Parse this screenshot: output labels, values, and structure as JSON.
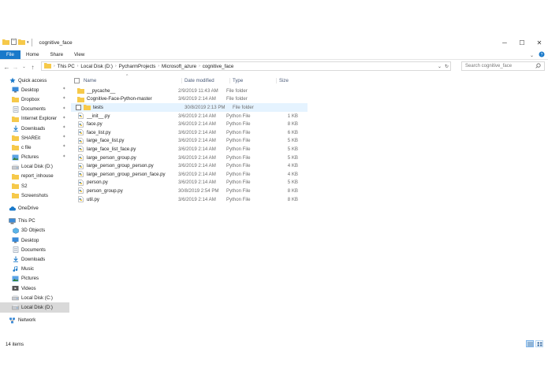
{
  "window": {
    "title": "cognitive_face",
    "controls": {
      "minimize": "─",
      "maximize": "☐",
      "close": "✕"
    }
  },
  "ribbon": {
    "tabs": [
      "File",
      "Home",
      "Share",
      "View"
    ],
    "expand_icon": "chevron-down-icon",
    "help_icon": "help-icon"
  },
  "address": {
    "crumbs": [
      "This PC",
      "Local Disk (D:)",
      "PycharmProjects",
      "Microsoft_azure",
      "cognitive_face"
    ],
    "search_placeholder": "Search cognitive_face"
  },
  "nav": {
    "items": [
      {
        "label": "Quick access",
        "icon": "star-icon",
        "level": 0,
        "pinned": false
      },
      {
        "label": "Desktop",
        "icon": "desktop-icon",
        "level": 1,
        "pinned": true
      },
      {
        "label": "Dropbox",
        "icon": "folder-icon",
        "level": 1,
        "pinned": true
      },
      {
        "label": "Documents",
        "icon": "documents-icon",
        "level": 1,
        "pinned": true
      },
      {
        "label": "Internet Explorer",
        "icon": "folder-icon",
        "level": 1,
        "pinned": true
      },
      {
        "label": "Downloads",
        "icon": "downloads-icon",
        "level": 1,
        "pinned": true
      },
      {
        "label": "SHAREit",
        "icon": "folder-icon",
        "level": 1,
        "pinned": true
      },
      {
        "label": "c file",
        "icon": "folder-icon",
        "level": 1,
        "pinned": true
      },
      {
        "label": "Pictures",
        "icon": "pictures-icon",
        "level": 1,
        "pinned": true
      },
      {
        "label": "Local Disk (D:)",
        "icon": "drive-icon",
        "level": 1,
        "pinned": false
      },
      {
        "label": "report_inhouse",
        "icon": "folder-icon",
        "level": 1,
        "pinned": false
      },
      {
        "label": "S2",
        "icon": "folder-icon",
        "level": 1,
        "pinned": false
      },
      {
        "label": "Screenshots",
        "icon": "folder-icon",
        "level": 1,
        "pinned": false
      },
      {
        "label": "",
        "icon": "",
        "level": 0,
        "pinned": false,
        "spacer": true
      },
      {
        "label": "OneDrive",
        "icon": "cloud-icon",
        "level": 0,
        "pinned": false
      },
      {
        "label": "",
        "icon": "",
        "level": 0,
        "pinned": false,
        "spacer": true
      },
      {
        "label": "This PC",
        "icon": "computer-icon",
        "level": 0,
        "pinned": false
      },
      {
        "label": "3D Objects",
        "icon": "cube-icon",
        "level": 1,
        "pinned": false
      },
      {
        "label": "Desktop",
        "icon": "desktop-icon",
        "level": 1,
        "pinned": false
      },
      {
        "label": "Documents",
        "icon": "documents-icon",
        "level": 1,
        "pinned": false
      },
      {
        "label": "Downloads",
        "icon": "downloads-icon",
        "level": 1,
        "pinned": false
      },
      {
        "label": "Music",
        "icon": "music-icon",
        "level": 1,
        "pinned": false
      },
      {
        "label": "Pictures",
        "icon": "pictures-icon",
        "level": 1,
        "pinned": false
      },
      {
        "label": "Videos",
        "icon": "videos-icon",
        "level": 1,
        "pinned": false
      },
      {
        "label": "Local Disk (C:)",
        "icon": "drive-icon",
        "level": 1,
        "pinned": false
      },
      {
        "label": "Local Disk (D:)",
        "icon": "drive-icon",
        "level": 1,
        "pinned": false,
        "selected": true
      },
      {
        "label": "",
        "icon": "",
        "level": 0,
        "pinned": false,
        "spacer": true
      },
      {
        "label": "Network",
        "icon": "network-icon",
        "level": 0,
        "pinned": false
      }
    ]
  },
  "files": {
    "columns": {
      "name": "Name",
      "date": "Date modified",
      "type": "Type",
      "size": "Size"
    },
    "rows": [
      {
        "name": "__pycache__",
        "date": "2/9/2019 11:43 AM",
        "type": "File folder",
        "size": "",
        "kind": "folder"
      },
      {
        "name": "Cognitive-Face-Python-master",
        "date": "3/6/2019 2:14 AM",
        "type": "File folder",
        "size": "",
        "kind": "folder"
      },
      {
        "name": "tests",
        "date": "30/8/2019 2:13 PM",
        "type": "File folder",
        "size": "",
        "kind": "folder",
        "hover": true
      },
      {
        "name": "__init__.py",
        "date": "3/6/2019 2:14 AM",
        "type": "Python File",
        "size": "1 KB",
        "kind": "py"
      },
      {
        "name": "face.py",
        "date": "3/6/2019 2:14 AM",
        "type": "Python File",
        "size": "8 KB",
        "kind": "py"
      },
      {
        "name": "face_list.py",
        "date": "3/6/2019 2:14 AM",
        "type": "Python File",
        "size": "6 KB",
        "kind": "py"
      },
      {
        "name": "large_face_list.py",
        "date": "3/6/2019 2:14 AM",
        "type": "Python File",
        "size": "5 KB",
        "kind": "py"
      },
      {
        "name": "large_face_list_face.py",
        "date": "3/6/2019 2:14 AM",
        "type": "Python File",
        "size": "5 KB",
        "kind": "py"
      },
      {
        "name": "large_person_group.py",
        "date": "3/6/2019 2:14 AM",
        "type": "Python File",
        "size": "5 KB",
        "kind": "py"
      },
      {
        "name": "large_person_group_person.py",
        "date": "3/6/2019 2:14 AM",
        "type": "Python File",
        "size": "4 KB",
        "kind": "py"
      },
      {
        "name": "large_person_group_person_face.py",
        "date": "3/6/2019 2:14 AM",
        "type": "Python File",
        "size": "4 KB",
        "kind": "py"
      },
      {
        "name": "person.py",
        "date": "3/6/2019 2:14 AM",
        "type": "Python File",
        "size": "5 KB",
        "kind": "py"
      },
      {
        "name": "person_group.py",
        "date": "30/8/2019 2:54 PM",
        "type": "Python File",
        "size": "8 KB",
        "kind": "py"
      },
      {
        "name": "util.py",
        "date": "3/6/2019 2:14 AM",
        "type": "Python File",
        "size": "8 KB",
        "kind": "py"
      }
    ]
  },
  "status": {
    "item_count": "14 items"
  },
  "colors": {
    "accent": "#1979ca",
    "folder": "#f6c94a",
    "selected": "#d9d9d9",
    "hover": "#e5f3ff"
  }
}
